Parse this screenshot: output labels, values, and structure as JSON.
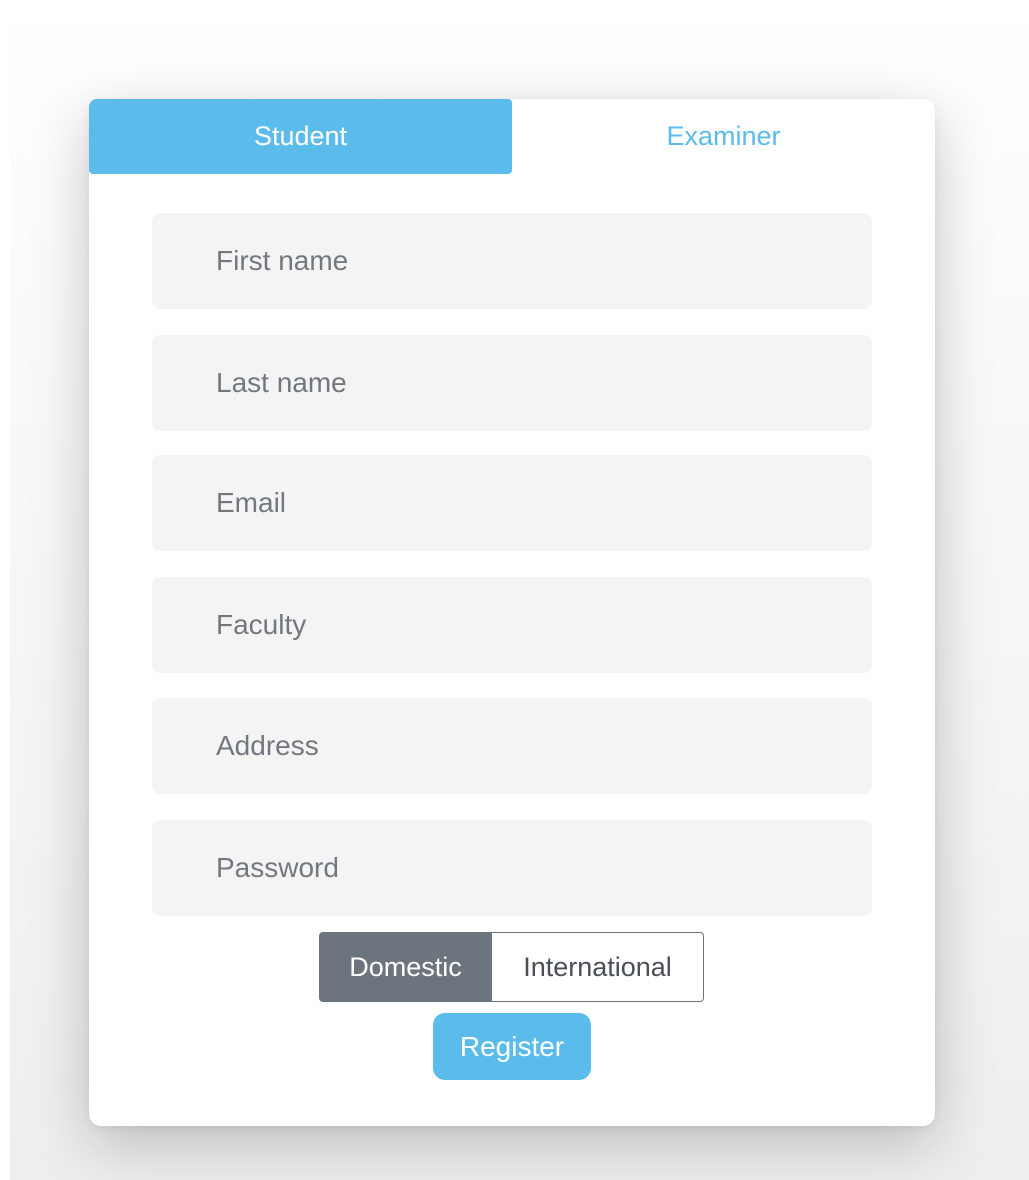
{
  "tabs": [
    {
      "label": "Student",
      "active": true
    },
    {
      "label": "Examiner",
      "active": false
    }
  ],
  "form": {
    "fields": [
      {
        "placeholder": "First name",
        "value": ""
      },
      {
        "placeholder": "Last name",
        "value": ""
      },
      {
        "placeholder": "Email",
        "value": ""
      },
      {
        "placeholder": "Faculty",
        "value": ""
      },
      {
        "placeholder": "Address",
        "value": ""
      },
      {
        "placeholder": "Password",
        "value": ""
      }
    ],
    "residency": {
      "options": [
        "Domestic",
        "International"
      ],
      "selected": "Domestic"
    },
    "submit_label": "Register"
  },
  "colors": {
    "accent": "#5bbcec",
    "selected_toggle": "#6c757d",
    "input_background": "#f4f4f5",
    "placeholder_text": "#72787e"
  }
}
